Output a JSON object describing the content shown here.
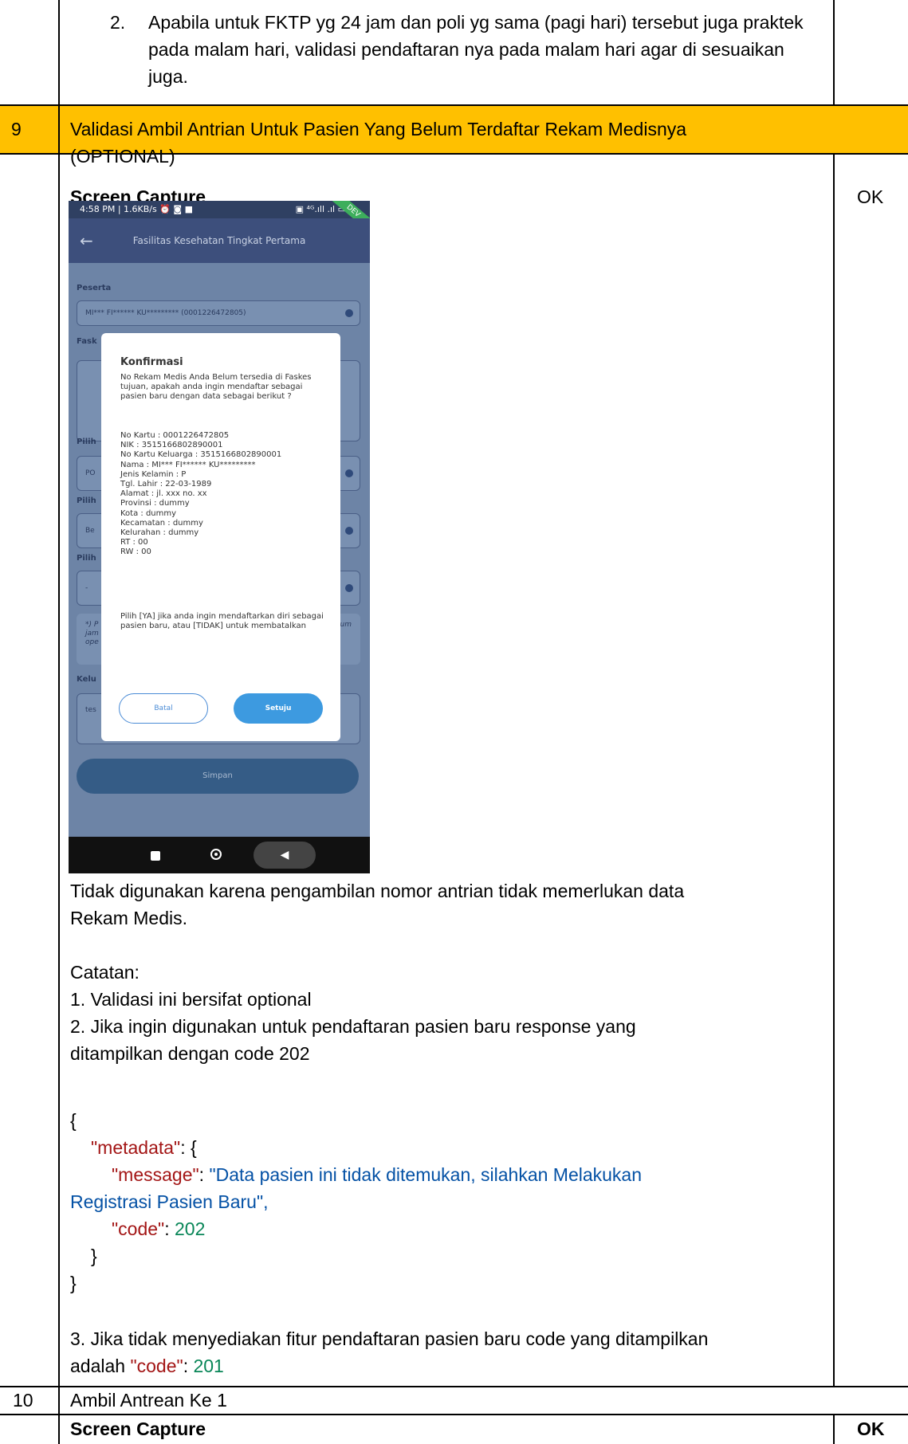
{
  "row_prev": {
    "item_marker": "2.",
    "item_text": "Apabila untuk FKTP yg 24 jam dan poli yg sama (pagi hari) tersebut juga praktek pada malam hari, validasi pendaftaran nya pada malam hari agar di sesuaikan juga."
  },
  "row9": {
    "number": "9",
    "title_line1": "Validasi Ambil Antrian Untuk Pasien Yang Belum Terdaftar Rekam Medisnya",
    "title_line2": "(OPTIONAL)",
    "screen_capture_label": "Screen Capture",
    "status": "OK",
    "description_line1": "Tidak digunakan karena pengambilan nomor antrian tidak memerlukan data",
    "description_line2": "Rekam Medis.",
    "catatan_label": "Catatan:",
    "note1": "1. Validasi ini bersifat optional",
    "note2_line1": "2. Jika ingin digunakan untuk pendaftaran pasien baru response yang",
    "note2_line2": "ditampilkan dengan code 202",
    "json": {
      "open": "{",
      "metadata_key": "\"metadata\"",
      "metadata_open": ": {",
      "message_key": "\"message\"",
      "colon1": ": ",
      "message_val_line1": "\"Data pasien ini tidak ditemukan, silahkan Melakukan",
      "message_val_line2": "Registrasi Pasien Baru\"",
      "comma1": ",",
      "code_key": "\"code\"",
      "colon2": ": ",
      "code_val": "202",
      "inner_close": "}",
      "outer_close": "}"
    },
    "note3_line1": "3. Jika tidak menyediakan fitur pendaftaran pasien baru code yang ditampilkan",
    "note3_prefix": "adalah ",
    "note3_code_key": "\"code\"",
    "note3_colon": ": ",
    "note3_code_val": "201"
  },
  "row10": {
    "number": "10",
    "title": "Ambil Antrean Ke 1",
    "screen_capture_label": "Screen Capture",
    "status": "OK"
  },
  "phone": {
    "status_time": "4:58 PM | 1.6KB/s ⏰ ◙ ■",
    "status_right": "▣ ⁴ᴳ.ıll .ıl ▭",
    "ribbon": "DEV",
    "back_icon": "←",
    "appbar_title": "Fasilitas Kesehatan Tingkat Pertama",
    "peserta_label": "Peserta",
    "peserta_value": "MI*** FI****** KU********* (0001226472805)",
    "faskes_label": "Fask",
    "pilih1_label": "Pilih",
    "pilih1_value": "PO",
    "pilih2_label": "Pilih",
    "pilih2_value": "Be",
    "pilih3_label": "Pilih",
    "pilih3_value": "-",
    "note_text_left": "*) P\njam\nope",
    "note_text_right": "um",
    "keluhan_label": "Kelu",
    "keluhan_value": "tes",
    "simpan": "Simpan",
    "dialog": {
      "title": "Konfirmasi",
      "intro": "No Rekam Medis Anda Belum tersedia di Faskes tujuan, apakah anda ingin mendaftar sebagai pasien baru dengan data sebagai berikut ?",
      "lines": [
        "No Kartu : 0001226472805",
        "NIK : 3515166802890001",
        "No Kartu Keluarga : 3515166802890001",
        "Nama : MI*** FI****** KU*********",
        "Jenis Kelamin : P",
        "Tgl. Lahir : 22-03-1989",
        "Alamat : jl. xxx no. xx",
        "Provinsi : dummy",
        "Kota : dummy",
        "Kecamatan : dummy",
        "Kelurahan : dummy",
        "RT : 00",
        "RW : 00"
      ],
      "outro": "Pilih [YA] jika anda ingin mendaftarkan diri sebagai pasien baru, atau [TIDAK] untuk membatalkan",
      "batal": "Batal",
      "setuju": "Setuju"
    },
    "nav_back": "◀"
  }
}
